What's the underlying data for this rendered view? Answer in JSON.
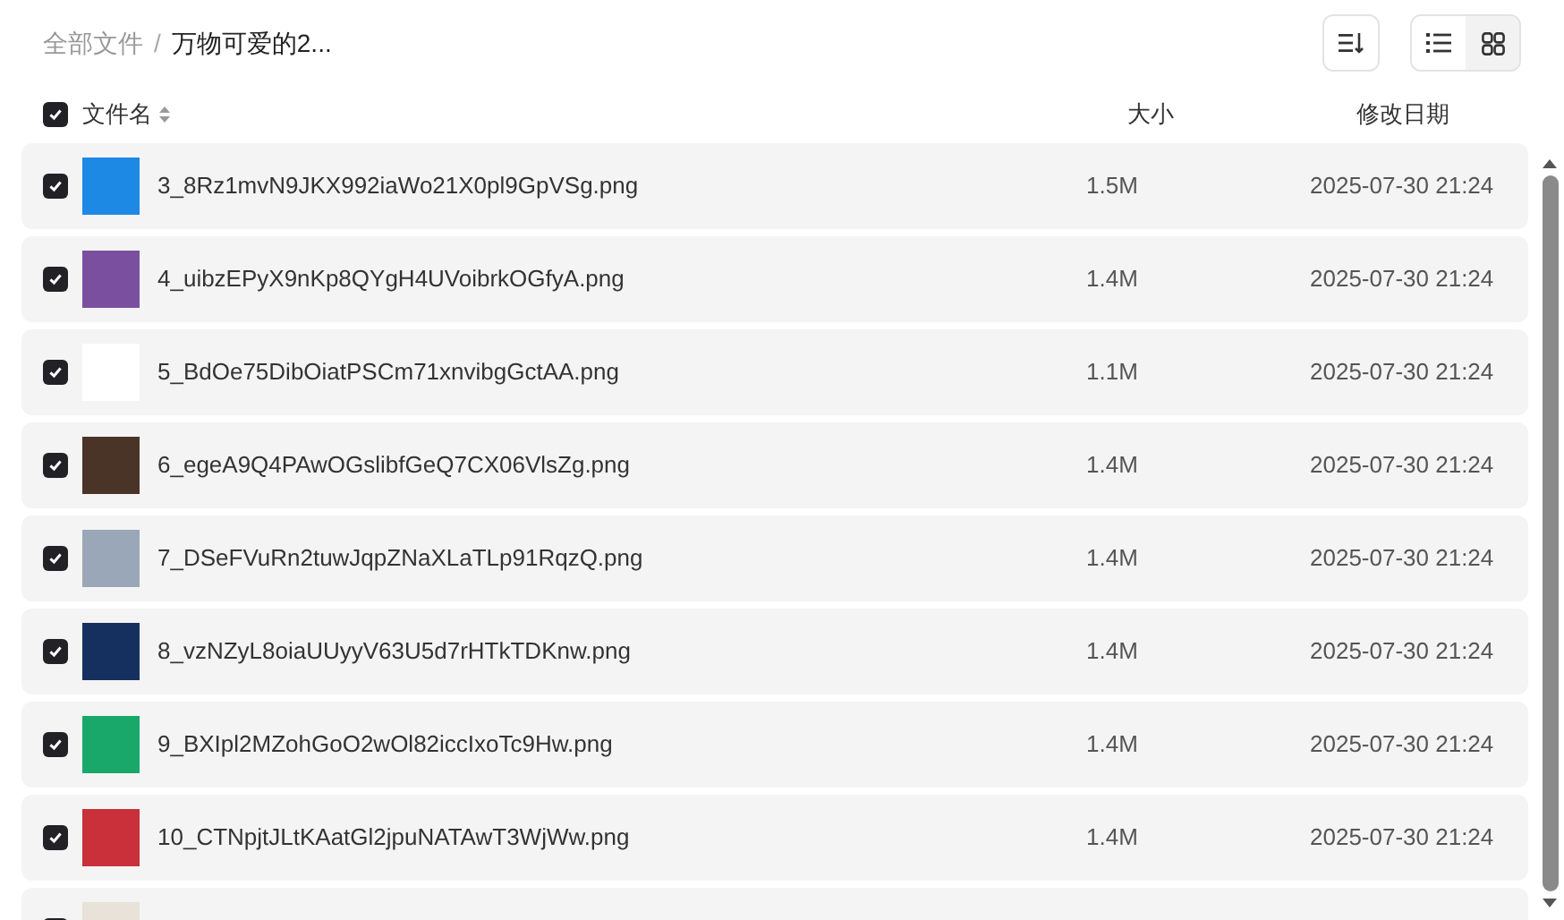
{
  "breadcrumb_separator": "/",
  "breadcrumb": [
    {
      "label": "全部文件",
      "current": false
    },
    {
      "label": "万物可爱的2...",
      "current": true
    }
  ],
  "view_modes": [
    {
      "kind": "list",
      "selected": true
    },
    {
      "kind": "grid",
      "selected": false
    }
  ],
  "header": {
    "checked": true,
    "name": "文件名",
    "size": "大小",
    "date": "修改日期"
  },
  "rows": [
    {
      "checked": true,
      "name": "3_8Rz1mvN9JKX992iaWo21X0pl9GpVSg.png",
      "size": "1.5M",
      "date": "2025-07-30 21:24"
    },
    {
      "checked": true,
      "name": "4_uibzEPyX9nKp8QYgH4UVoibrkOGfyA.png",
      "size": "1.4M",
      "date": "2025-07-30 21:24"
    },
    {
      "checked": true,
      "name": "5_BdOe75DibOiatPSCm71xnvibgGctAA.png",
      "size": "1.1M",
      "date": "2025-07-30 21:24"
    },
    {
      "checked": true,
      "name": "6_egeA9Q4PAwOGslibfGeQ7CX06VlsZg.png",
      "size": "1.4M",
      "date": "2025-07-30 21:24"
    },
    {
      "checked": true,
      "name": "7_DSeFVuRn2tuwJqpZNaXLaTLp91RqzQ.png",
      "size": "1.4M",
      "date": "2025-07-30 21:24"
    },
    {
      "checked": true,
      "name": "8_vzNZyL8oiaUUyyV63U5d7rHTkTDKnw.png",
      "size": "1.4M",
      "date": "2025-07-30 21:24"
    },
    {
      "checked": true,
      "name": "9_BXIpl2MZohGoO2wOl82iccIxoTc9Hw.png",
      "size": "1.4M",
      "date": "2025-07-30 21:24"
    },
    {
      "checked": true,
      "name": "10_CTNpjtJLtKAatGl2jpuNATAwT3WjWw.png",
      "size": "1.4M",
      "date": "2025-07-30 21:24"
    },
    {
      "checked": true
    }
  ]
}
